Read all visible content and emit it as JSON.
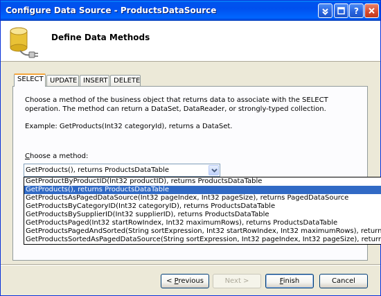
{
  "window": {
    "title": "Configure Data Source - ProductsDataSource"
  },
  "header": {
    "title": "Define Data Methods"
  },
  "tabs": [
    {
      "label": "SELECT"
    },
    {
      "label": "UPDATE"
    },
    {
      "label": "INSERT"
    },
    {
      "label": "DELETE"
    }
  ],
  "panel": {
    "description": "Choose a method of the business object that returns data to associate with the SELECT operation. The method can return a DataSet, DataReader, or strongly-typed collection.",
    "example": "Example: GetProducts(Int32 categoryId), returns a DataSet.",
    "choose_label_prefix": "C",
    "choose_label_rest": "hoose a method:",
    "selected_method": "GetProducts(), returns ProductsDataTable",
    "methods": [
      "GetProductByProductID(Int32 productID), returns ProductsDataTable",
      "GetProducts(), returns ProductsDataTable",
      "GetProductsAsPagedDataSource(Int32 pageIndex, Int32 pageSize), returns PagedDataSource",
      "GetProductsByCategoryID(Int32 categoryID), returns ProductsDataTable",
      "GetProductsBySupplierID(Int32 supplierID), returns ProductsDataTable",
      "GetProductsPaged(Int32 startRowIndex, Int32 maximumRows), returns ProductsDataTable",
      "GetProductsPagedAndSorted(String sortExpression, Int32 startRowIndex, Int32 maximumRows), returns ProductsDataTable",
      "GetProductsSortedAsPagedDataSource(String sortExpression, Int32 pageIndex, Int32 pageSize), returns PagedDataSource"
    ]
  },
  "buttons": {
    "previous_prefix": "< ",
    "previous_key": "P",
    "previous_rest": "revious",
    "next_label": "Next >",
    "finish_key": "F",
    "finish_rest": "inish",
    "cancel_label": "Cancel"
  }
}
